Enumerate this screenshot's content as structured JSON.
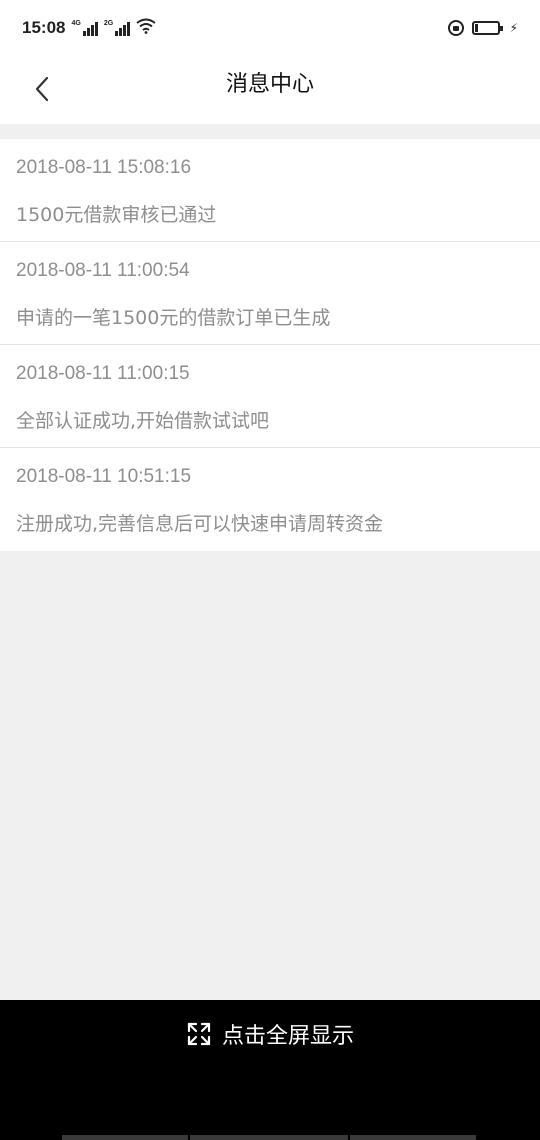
{
  "status_bar": {
    "time": "15:08",
    "network_1": "4G",
    "network_2": "2G"
  },
  "header": {
    "title": "消息中心"
  },
  "messages": [
    {
      "time": "2018-08-11 15:08:16",
      "text": "1500元借款审核已通过"
    },
    {
      "time": "2018-08-11 11:00:54",
      "text": "申请的一笔1500元的借款订单已生成"
    },
    {
      "time": "2018-08-11 11:00:15",
      "text": "全部认证成功,开始借款试试吧"
    },
    {
      "time": "2018-08-11 10:51:15",
      "text": "注册成功,完善信息后可以快速申请周转资金"
    }
  ],
  "fullscreen": {
    "label": "点击全屏显示"
  },
  "colors": {
    "background": "#f0f0f0",
    "card": "#ffffff",
    "muted_text": "#8e8e8e",
    "bottom_bar": "#000000"
  }
}
